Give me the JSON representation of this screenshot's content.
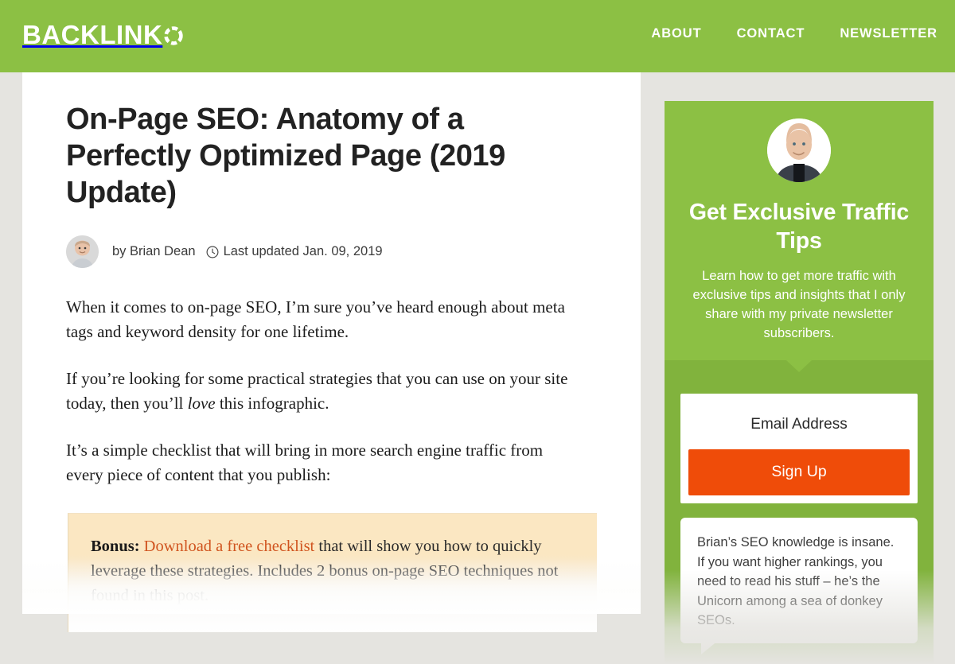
{
  "theme": {
    "brand_green": "#8cc044",
    "brand_green_dark": "#81b33d",
    "page_background": "#e5e4e0",
    "cta_orange": "#ef4c09",
    "link_orange": "#d0541f",
    "bonus_background": "#fbe7c2"
  },
  "header": {
    "logo_text": "BACKLINK",
    "logo_ring_icon": "dashed-circle-icon",
    "nav": [
      {
        "label": "ABOUT"
      },
      {
        "label": "CONTACT"
      },
      {
        "label": "NEWSLETTER"
      }
    ]
  },
  "article": {
    "title": "On-Page SEO: Anatomy of a Perfectly Optimized Page (2019 Update)",
    "byline": {
      "author_prefix": "by",
      "author": "Brian Dean",
      "author_line": "by Brian Dean",
      "clock_icon": "clock-icon",
      "updated_label": "Last updated Jan. 09, 2019",
      "avatar_alt": "Brian Dean"
    },
    "paragraphs": [
      "When it comes to on-page SEO, I’m sure you’ve heard enough about meta tags and keyword density for one lifetime.",
      "It’s a simple checklist that will bring in more search engine traffic from every piece of content that you publish:"
    ],
    "paragraph_2": {
      "before": "If you’re looking for some practical strategies that you can use on your site today, then you’ll ",
      "emphasis": "love",
      "after": " this infographic."
    },
    "bonus": {
      "label": "Bonus:",
      "link_text": "Download a free checklist",
      "rest": " that will show you how to quickly leverage these strategies. Includes 2 bonus on-page SEO techniques not found in this post."
    }
  },
  "sidebar": {
    "headshot_alt": "Brian Dean headshot",
    "title": "Get Exclusive Traffic Tips",
    "subtitle": "Learn how to get more traffic with exclusive tips and insights that I only share with my private newsletter subscribers.",
    "form": {
      "email_placeholder": "Email Address",
      "email_value": "",
      "submit_label": "Sign Up"
    },
    "testimonial": {
      "quote": "Brian’s SEO knowledge is insane. If you want higher rankings, you need to read his stuff – he’s the Unicorn among a sea of donkey SEOs."
    }
  }
}
